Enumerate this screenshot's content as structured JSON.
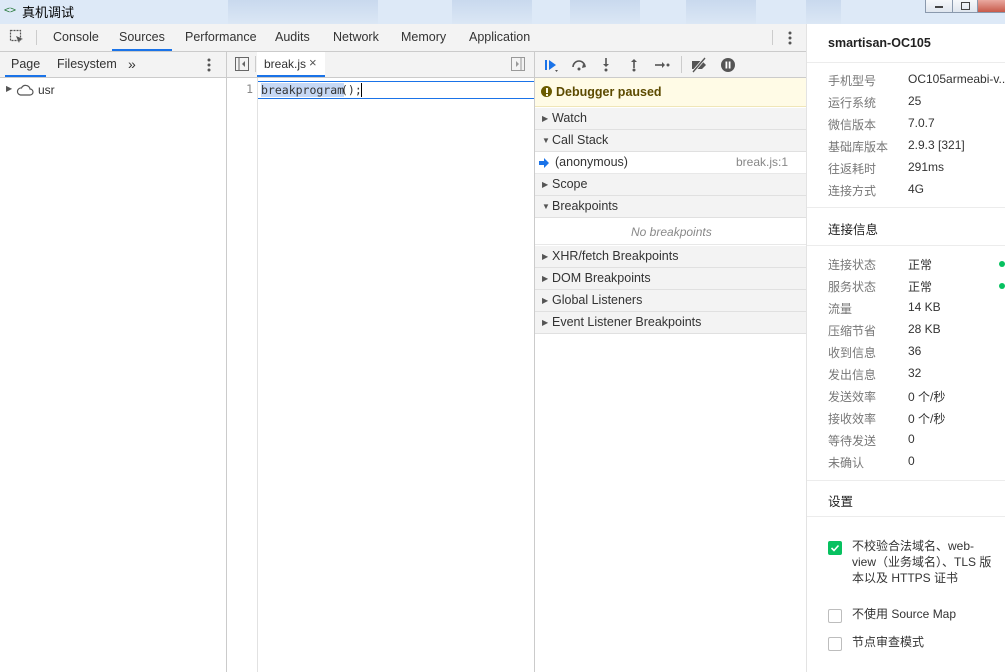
{
  "window": {
    "title": "真机调试",
    "icon": "code-brackets-icon"
  },
  "devtools_tabs": [
    "Console",
    "Sources",
    "Performance",
    "Audits",
    "Network",
    "Memory",
    "Application"
  ],
  "active_tab": "Sources",
  "navigator": {
    "tabs": [
      "Page",
      "Filesystem"
    ],
    "more": "»",
    "tree": [
      {
        "label": "usr",
        "icon": "cloud-icon"
      }
    ]
  },
  "editor": {
    "file_tab": "break.js",
    "close_glyph": "×",
    "lines": [
      {
        "number": "1",
        "selected": "breakprogram",
        "rest": "();"
      }
    ]
  },
  "debugger": {
    "paused_label": "Debugger paused",
    "sections": {
      "watch": "Watch",
      "call_stack": "Call Stack",
      "scope": "Scope",
      "breakpoints": "Breakpoints",
      "xhr": "XHR/fetch Breakpoints",
      "dom": "DOM Breakpoints",
      "global": "Global Listeners",
      "event": "Event Listener Breakpoints"
    },
    "call_frame": {
      "name": "(anonymous)",
      "location": "break.js:1"
    },
    "no_breakpoints": "No breakpoints"
  },
  "device_panel": {
    "device_name": "smartisan-OC105",
    "info": [
      {
        "k": "手机型号",
        "v": "OC105armeabi-v..."
      },
      {
        "k": "运行系统",
        "v": "25"
      },
      {
        "k": "微信版本",
        "v": "7.0.7"
      },
      {
        "k": "基础库版本",
        "v": "2.9.3 [321]"
      },
      {
        "k": "往返耗时",
        "v": "291ms"
      },
      {
        "k": "连接方式",
        "v": "4G"
      }
    ],
    "conn_title": "连接信息",
    "conn": [
      {
        "k": "连接状态",
        "v": "正常"
      },
      {
        "k": "服务状态",
        "v": "正常"
      },
      {
        "k": "流量",
        "v": "14 KB"
      },
      {
        "k": "压缩节省",
        "v": "28 KB"
      },
      {
        "k": "收到信息",
        "v": "36"
      },
      {
        "k": "发出信息",
        "v": "32"
      },
      {
        "k": "发送效率",
        "v": "0 个/秒"
      },
      {
        "k": "接收效率",
        "v": "0 个/秒"
      },
      {
        "k": "等待发送",
        "v": "0"
      },
      {
        "k": "未确认",
        "v": "0"
      }
    ],
    "settings_title": "设置",
    "settings": [
      {
        "lines": [
          "不校验合法域名、web-",
          "view（业务域名）、TLS 版",
          "本以及 HTTPS 证书"
        ],
        "checked": true
      },
      {
        "lines": [
          "不使用 Source Map"
        ],
        "checked": false
      },
      {
        "lines": [
          "节点审查模式"
        ],
        "checked": false
      }
    ],
    "status_color": "#07c160"
  },
  "colors": {
    "accent": "#1a73e8",
    "paused_bg": "#fffbe6"
  }
}
